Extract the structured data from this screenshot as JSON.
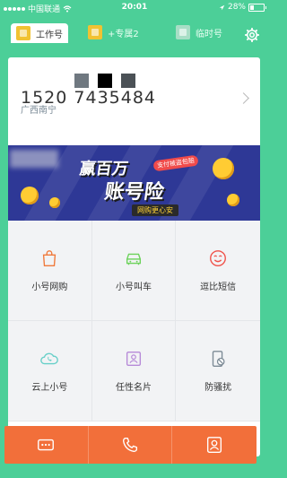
{
  "status": {
    "carrier": "中国联通",
    "time": "20:01",
    "battery_text": "28%",
    "battery_level": 0.28
  },
  "tabs": [
    {
      "label": "工作号",
      "active": true
    },
    {
      "label": "+专属2",
      "active": false
    },
    {
      "label": "临时号",
      "active": false
    }
  ],
  "account": {
    "phone_number": "1520 7435484",
    "city": "广西南宁"
  },
  "banner": {
    "tag": "支付被盗包赔",
    "title_line1": "赢百万",
    "title_line2": "账号险",
    "subtitle": "网购更心安"
  },
  "features": [
    {
      "label": "小号网购",
      "icon": "shopping-bag-icon"
    },
    {
      "label": "小号叫车",
      "icon": "car-icon"
    },
    {
      "label": "逗比短信",
      "icon": "smiley-icon"
    },
    {
      "label": "云上小号",
      "icon": "cloud-phone-icon"
    },
    {
      "label": "任性名片",
      "icon": "contact-card-icon"
    },
    {
      "label": "防骚扰",
      "icon": "block-phone-icon"
    }
  ],
  "bottom_bar": [
    {
      "icon": "message-icon"
    },
    {
      "icon": "phone-icon"
    },
    {
      "icon": "contacts-icon"
    }
  ],
  "colors": {
    "accent": "#4ccf98",
    "cta": "#f26f3a",
    "icon_orange": "#f07a3c",
    "icon_green": "#6cd25a",
    "icon_red": "#f0524a",
    "icon_teal": "#66cfc8",
    "icon_purple": "#b78ad8",
    "icon_gray": "#7d8b96"
  }
}
